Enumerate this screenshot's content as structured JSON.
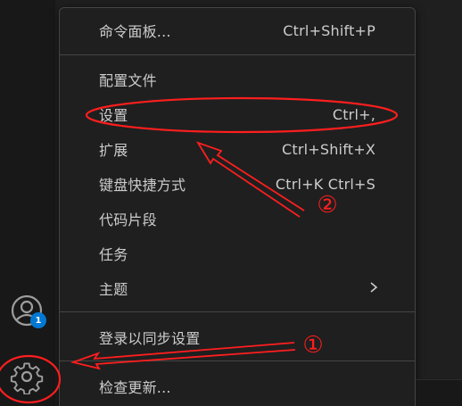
{
  "activity_bar": {
    "accounts_badge": "1"
  },
  "menu": {
    "items": [
      {
        "label": "命令面板...",
        "shortcut": "Ctrl+Shift+P"
      },
      {
        "label": "配置文件",
        "shortcut": ""
      },
      {
        "label": "设置",
        "shortcut": "Ctrl+,"
      },
      {
        "label": "扩展",
        "shortcut": "Ctrl+Shift+X"
      },
      {
        "label": "键盘快捷方式",
        "shortcut": "Ctrl+K Ctrl+S"
      },
      {
        "label": "代码片段",
        "shortcut": ""
      },
      {
        "label": "任务",
        "shortcut": ""
      },
      {
        "label": "主题",
        "shortcut": ""
      },
      {
        "label": "登录以同步设置",
        "shortcut": ""
      },
      {
        "label": "检查更新...",
        "shortcut": ""
      }
    ]
  },
  "annotations": {
    "marker_1": "①",
    "marker_2": "②",
    "color": "#ff1e1e"
  },
  "icons": {
    "accounts": "account-icon",
    "manage": "gear-icon",
    "submenu": "chevron-right-icon"
  }
}
